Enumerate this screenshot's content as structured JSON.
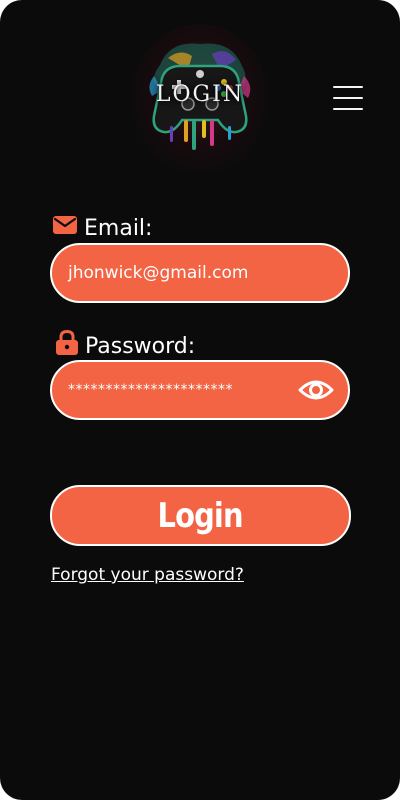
{
  "header": {
    "logo_title": "LOGIN",
    "logo_icon": "gamepad-icon",
    "menu_icon": "hamburger-menu-icon"
  },
  "form": {
    "email": {
      "label": "Email:",
      "icon": "mail-icon",
      "value": "jhonwick@gmail.com"
    },
    "password": {
      "label": "Password:",
      "icon": "lock-icon",
      "value": "**********************",
      "toggle_icon": "eye-icon"
    },
    "submit_label": "Login",
    "forgot_label": "Forgot your password?"
  },
  "colors": {
    "background": "#0b0b0b",
    "accent": "#f26443",
    "text": "#ffffff"
  }
}
